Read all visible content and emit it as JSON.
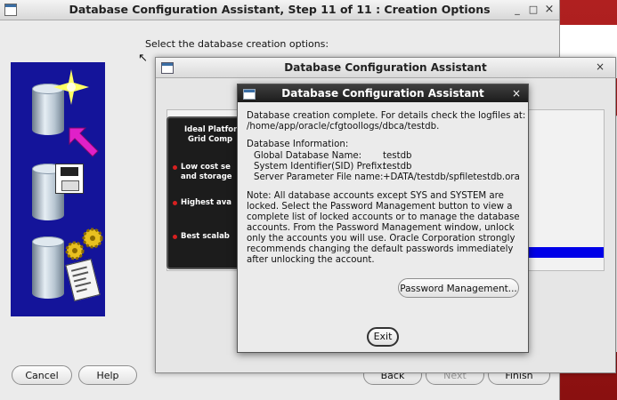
{
  "main_window": {
    "title": "Database Configuration Assistant, Step 11 of 11 : Creation Options",
    "minimize_glyph": "_",
    "maximize_glyph": "□",
    "close_glyph": "×",
    "prompt": "Select the database creation options:",
    "buttons": {
      "cancel": "Cancel",
      "help": "Help",
      "back": "Back",
      "next": "Next",
      "finish": "Finish"
    }
  },
  "background_window": {
    "title": "Database Configuration Assistant",
    "close_glyph": "×",
    "panel_heading_1": "Ideal Platfor",
    "panel_heading_2": "Grid Comp",
    "bullets": [
      "Low cost se",
      "and storage",
      "Highest ava",
      "Best scalab"
    ]
  },
  "dialog": {
    "title": "Database Configuration Assistant",
    "close_glyph": "×",
    "intro_line1": "Database creation complete. For details check the logfiles at:",
    "intro_line2": "/home/app/oracle/cfgtoollogs/dbca/testdb.",
    "info_heading": "Database Information:",
    "info": [
      {
        "label": "Global Database Name:",
        "value": "testdb"
      },
      {
        "label": "System Identifier(SID) Prefix:",
        "value": "testdb"
      },
      {
        "label": "Server Parameter File name:",
        "value": "+DATA/testdb/spfiletestdb.ora"
      }
    ],
    "note_lines": [
      "Note: All database accounts except SYS and SYSTEM are",
      "locked. Select the Password Management button to view a",
      "complete list of locked accounts or to manage the database",
      "accounts. From the Password Management window, unlock",
      "only the accounts you will use. Oracle Corporation strongly",
      "recommends changing the default passwords immediately",
      "after unlocking the account."
    ],
    "password_button": "Password Management...",
    "exit_button": "Exit"
  },
  "colors": {
    "illustration_bg": "#14149a",
    "progress_blue": "#0000e8",
    "dialog_title_bg": "#222222",
    "desktop_red": "#a01818"
  }
}
